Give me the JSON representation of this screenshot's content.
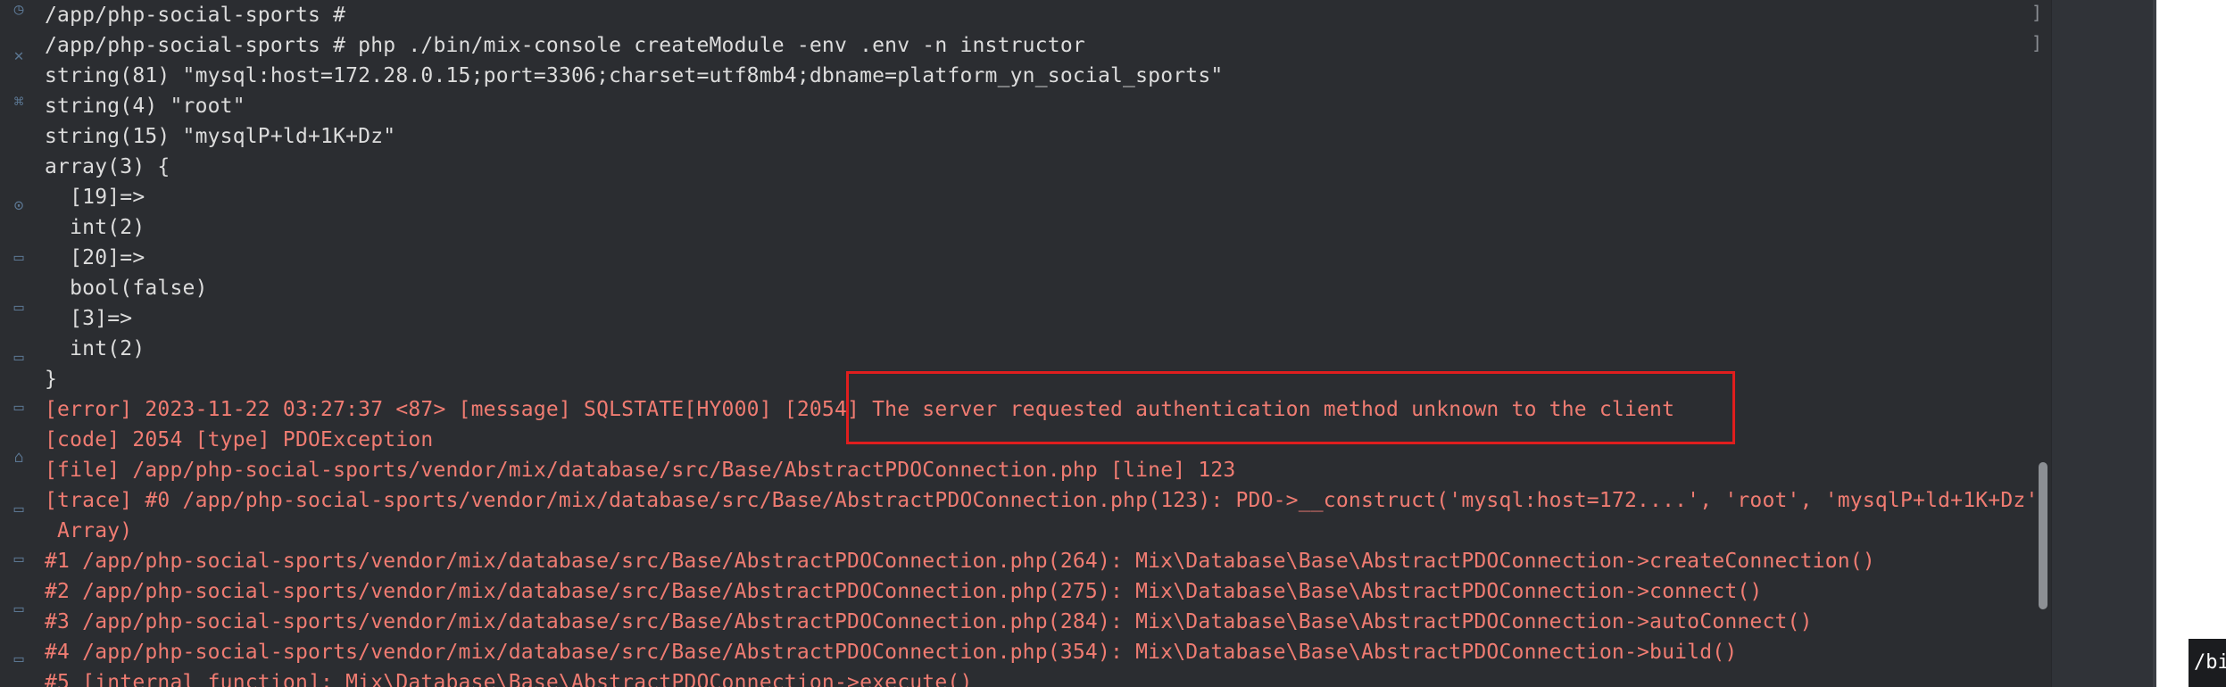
{
  "terminal": {
    "lines": [
      {
        "text": "/app/php-social-sports #",
        "kind": "normal"
      },
      {
        "text": "/app/php-social-sports # php ./bin/mix-console createModule -env .env -n instructor",
        "kind": "normal"
      },
      {
        "text": "string(81) \"mysql:host=172.28.0.15;port=3306;charset=utf8mb4;dbname=platform_yn_social_sports\"",
        "kind": "normal"
      },
      {
        "text": "string(4) \"root\"",
        "kind": "normal"
      },
      {
        "text": "string(15) \"mysqlP+ld+1K+Dz\"",
        "kind": "normal"
      },
      {
        "text": "array(3) {",
        "kind": "normal"
      },
      {
        "text": "  [19]=>",
        "kind": "normal"
      },
      {
        "text": "  int(2)",
        "kind": "normal"
      },
      {
        "text": "  [20]=>",
        "kind": "normal"
      },
      {
        "text": "  bool(false)",
        "kind": "normal"
      },
      {
        "text": "  [3]=>",
        "kind": "normal"
      },
      {
        "text": "  int(2)",
        "kind": "normal"
      },
      {
        "text": "}",
        "kind": "normal"
      },
      {
        "text": "[error] 2023-11-22 03:27:37 <87> [message] SQLSTATE[HY000] [2054] The server requested authentication method unknown to the client",
        "kind": "error"
      },
      {
        "text": "[code] 2054 [type] PDOException",
        "kind": "error"
      },
      {
        "text": "[file] /app/php-social-sports/vendor/mix/database/src/Base/AbstractPDOConnection.php [line] 123",
        "kind": "error"
      },
      {
        "text": "[trace] #0 /app/php-social-sports/vendor/mix/database/src/Base/AbstractPDOConnection.php(123): PDO->__construct('mysql:host=172....', 'root', 'mysqlP+ld+1K+Dz',",
        "kind": "error"
      },
      {
        "text": " Array)",
        "kind": "error"
      },
      {
        "text": "#1 /app/php-social-sports/vendor/mix/database/src/Base/AbstractPDOConnection.php(264): Mix\\Database\\Base\\AbstractPDOConnection->createConnection()",
        "kind": "error"
      },
      {
        "text": "#2 /app/php-social-sports/vendor/mix/database/src/Base/AbstractPDOConnection.php(275): Mix\\Database\\Base\\AbstractPDOConnection->connect()",
        "kind": "error"
      },
      {
        "text": "#3 /app/php-social-sports/vendor/mix/database/src/Base/AbstractPDOConnection.php(284): Mix\\Database\\Base\\AbstractPDOConnection->autoConnect()",
        "kind": "error"
      },
      {
        "text": "#4 /app/php-social-sports/vendor/mix/database/src/Base/AbstractPDOConnection.php(354): Mix\\Database\\Base\\AbstractPDOConnection->build()",
        "kind": "error"
      },
      {
        "text": "#5 [internal function]: Mix\\Database\\Base\\AbstractPDOConnection->execute()",
        "kind": "error"
      }
    ],
    "right_bracket": "]"
  },
  "mini_terminal_text": "/bi",
  "sidebar_icons": [
    "clock-icon",
    "tools-icon",
    "download-icon",
    "folder-icon",
    "folder-icon",
    "folder-icon",
    "folder-icon",
    "folder-icon",
    "home-icon",
    "folder-icon",
    "folder-icon",
    "folder-icon",
    "folder-icon"
  ],
  "colors": {
    "background": "#2b2d31",
    "text": "#dcdcdc",
    "error_text": "#f07c72",
    "highlight_border": "#e01e1e"
  }
}
